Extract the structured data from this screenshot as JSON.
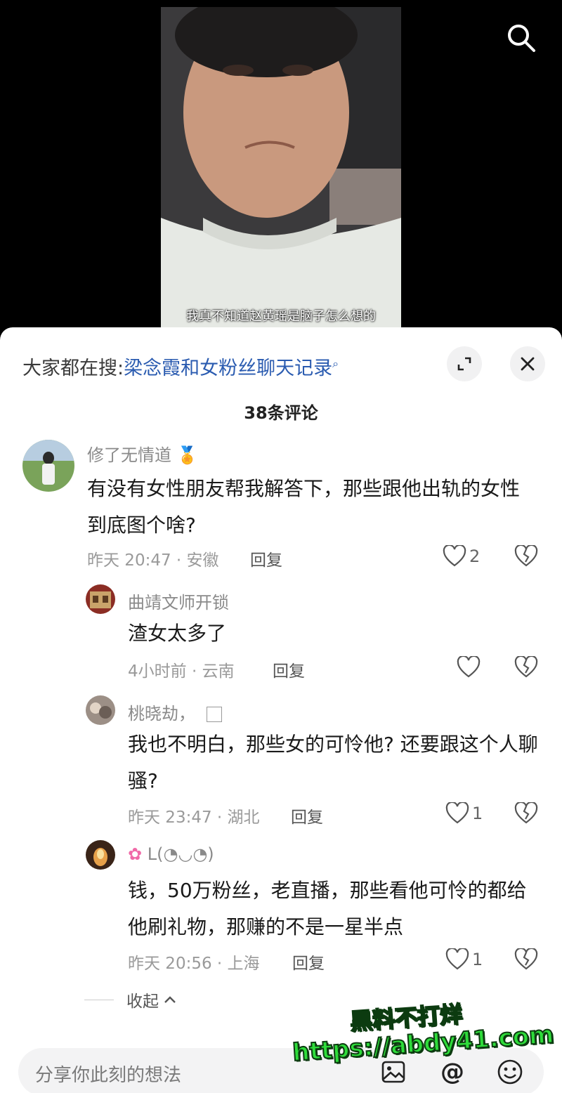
{
  "video": {
    "subtitle": "我真不知道赵黄瑶是脑子怎么想的"
  },
  "search_icon": "search-icon",
  "sheet": {
    "hot_search_prefix": "大家都在搜:",
    "hot_search_keyword": "梁念霞和女粉丝聊天记录",
    "comment_count": "38条评论"
  },
  "comments": [
    {
      "user": "修了无情道",
      "badge_icon": "medal-icon",
      "text": "有没有女性朋友帮我解答下，那些跟他出轨的女性到底图个啥?",
      "meta": "昨天 20:47 · 安徽",
      "reply": "回复",
      "likes": "2"
    },
    {
      "user": "曲靖文师开锁",
      "text": "渣女太多了",
      "meta": "4小时前 · 云南",
      "reply": "回复",
      "likes": ""
    },
    {
      "user": "桃晓劫，",
      "text": "我也不明白，那些女的可怜他? 还要跟这个人聊骚?",
      "meta": "昨天 23:47 · 湖北",
      "reply": "回复",
      "likes": "1"
    },
    {
      "user": "L(◔◡◔)",
      "user_prefix_icon": "flower-emoji",
      "text": "钱，50万粉丝，老直播，那些看他可怜的都给他刷礼物，那赚的不是一星半点",
      "meta": "昨天 20:56 · 上海",
      "reply": "回复",
      "likes": "1"
    }
  ],
  "collapse_label": "收起",
  "input": {
    "placeholder": "分享你此刻的想法"
  },
  "watermark": {
    "line1": "黑料不打烊",
    "line2": "https://abdy41.com"
  },
  "colors": {
    "keyword_blue": "#2a5bb0",
    "watermark_green": "#2edc3a"
  }
}
